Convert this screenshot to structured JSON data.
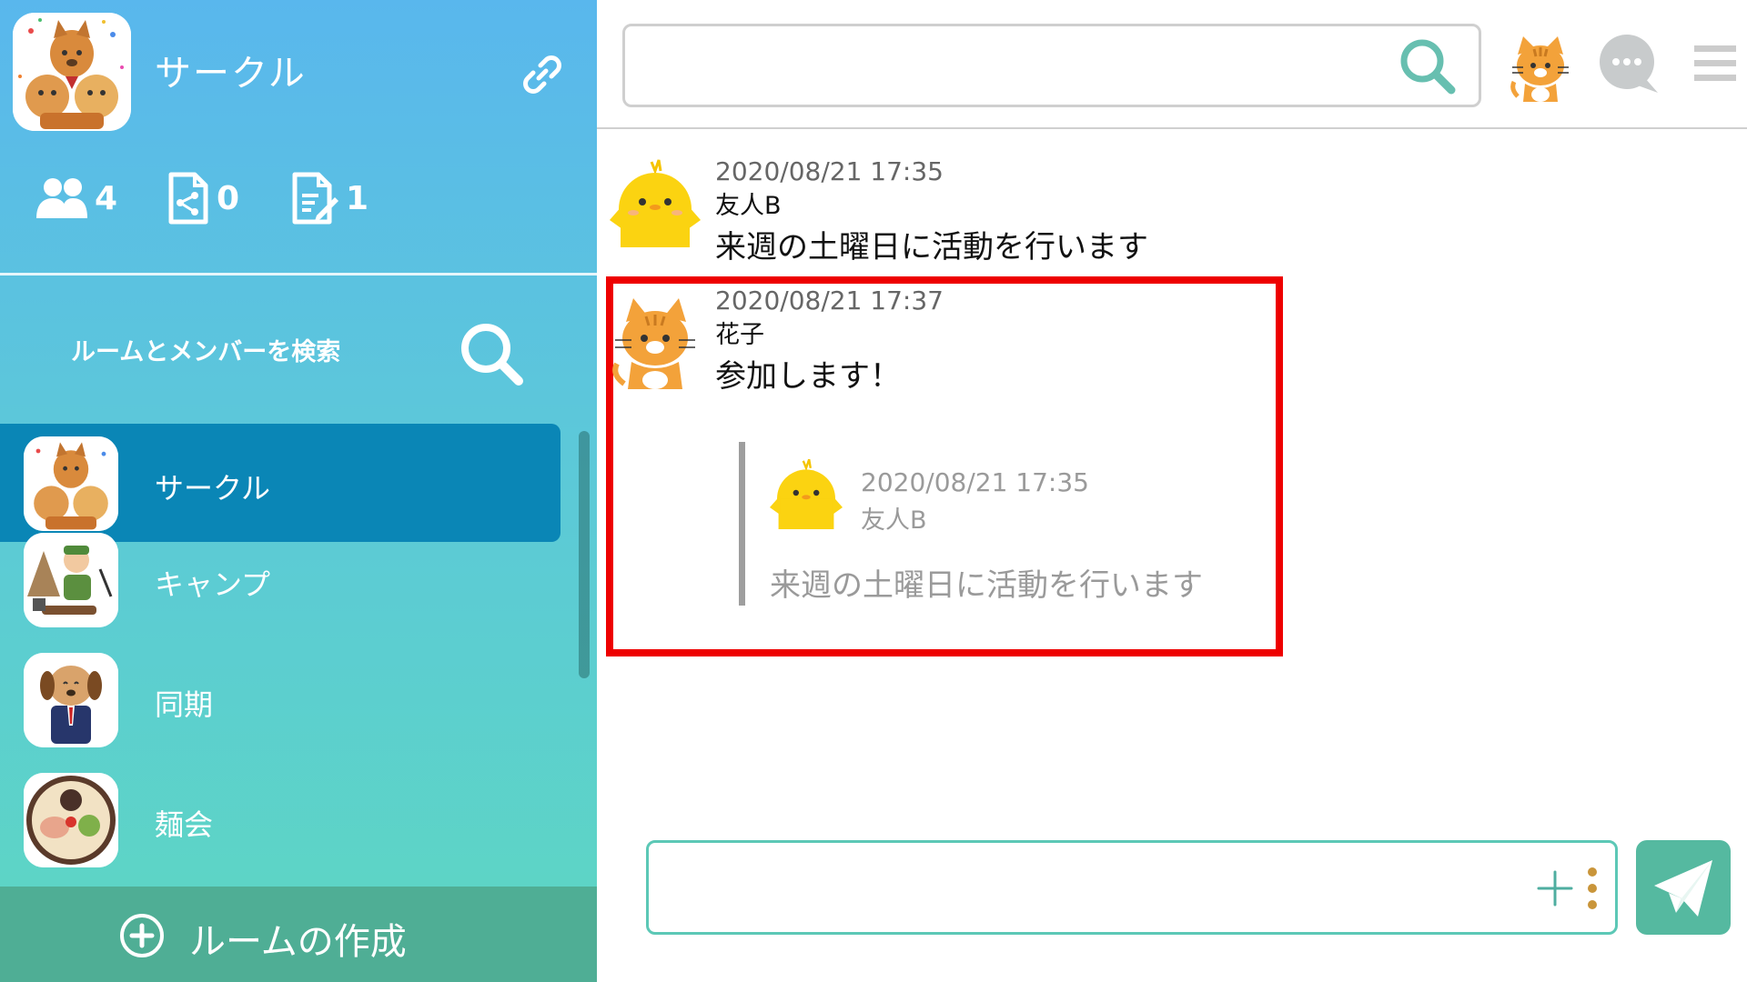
{
  "group": {
    "name": "サークル",
    "stats": {
      "members": "4",
      "files": "0",
      "notes": "1"
    }
  },
  "sidebar": {
    "search_label": "ルームとメンバーを検索",
    "rooms": [
      {
        "name": "サークル",
        "active": true
      },
      {
        "name": "キャンプ",
        "active": false
      },
      {
        "name": "同期",
        "active": false
      },
      {
        "name": "麺会",
        "active": false
      }
    ],
    "create_room_label": "ルームの作成"
  },
  "header": {
    "search_placeholder": ""
  },
  "messages": [
    {
      "time": "2020/08/21 17:35",
      "sender": "友人B",
      "text": "来週の土曜日に活動を行います",
      "avatar": "chick-icon"
    },
    {
      "time": "2020/08/21 17:37",
      "sender": "花子",
      "text": "参加します！",
      "avatar": "cat-icon",
      "quote": {
        "time": "2020/08/21 17:35",
        "sender": "友人B",
        "text": "来週の土曜日に活動を行います",
        "avatar": "chick-icon"
      }
    }
  ],
  "composer": {
    "placeholder": ""
  },
  "colors": {
    "sidebar_top": "#59b7ed",
    "sidebar_bottom": "#5dd7c2",
    "active_room": "#0a86b6",
    "create_room_bar": "#4fae95",
    "highlight": "#ee0000",
    "send_button": "#55b9a0"
  }
}
